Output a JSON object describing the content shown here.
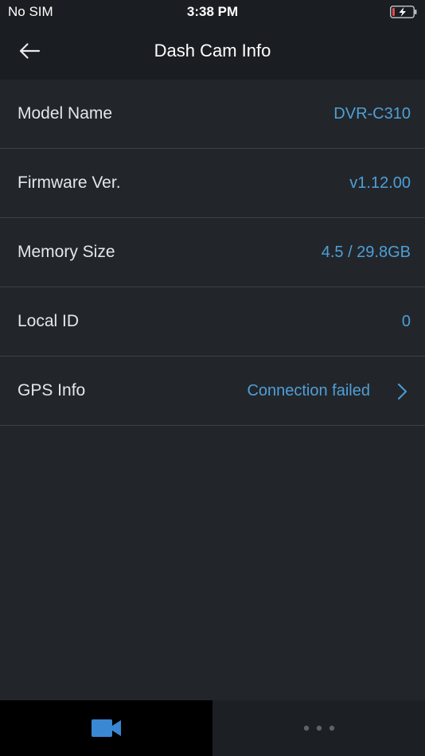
{
  "status_bar": {
    "carrier": "No SIM",
    "time": "3:38 PM",
    "battery_icon": "battery-charging-icon"
  },
  "nav": {
    "back_icon": "back-arrow-icon",
    "title": "Dash Cam Info"
  },
  "info_rows": [
    {
      "label": "Model Name",
      "value": "DVR-C310"
    },
    {
      "label": "Firmware Ver.",
      "value": "v1.12.00"
    },
    {
      "label": "Memory Size",
      "value": "4.5 / 29.8GB"
    },
    {
      "label": "Local ID",
      "value": "0"
    },
    {
      "label": "GPS Info",
      "value": "Connection failed",
      "icon": "chevron-right-icon"
    }
  ],
  "tab_bar": {
    "tabs": [
      {
        "icon": "video-camera-icon",
        "active": true
      },
      {
        "icon": "more-dots-icon",
        "active": false
      }
    ]
  },
  "colors": {
    "background": "#22262b",
    "header": "#1a1d21",
    "value_accent": "#4f9fd6",
    "camera_icon": "#3a87d4",
    "battery_alert": "#e24b4b"
  }
}
